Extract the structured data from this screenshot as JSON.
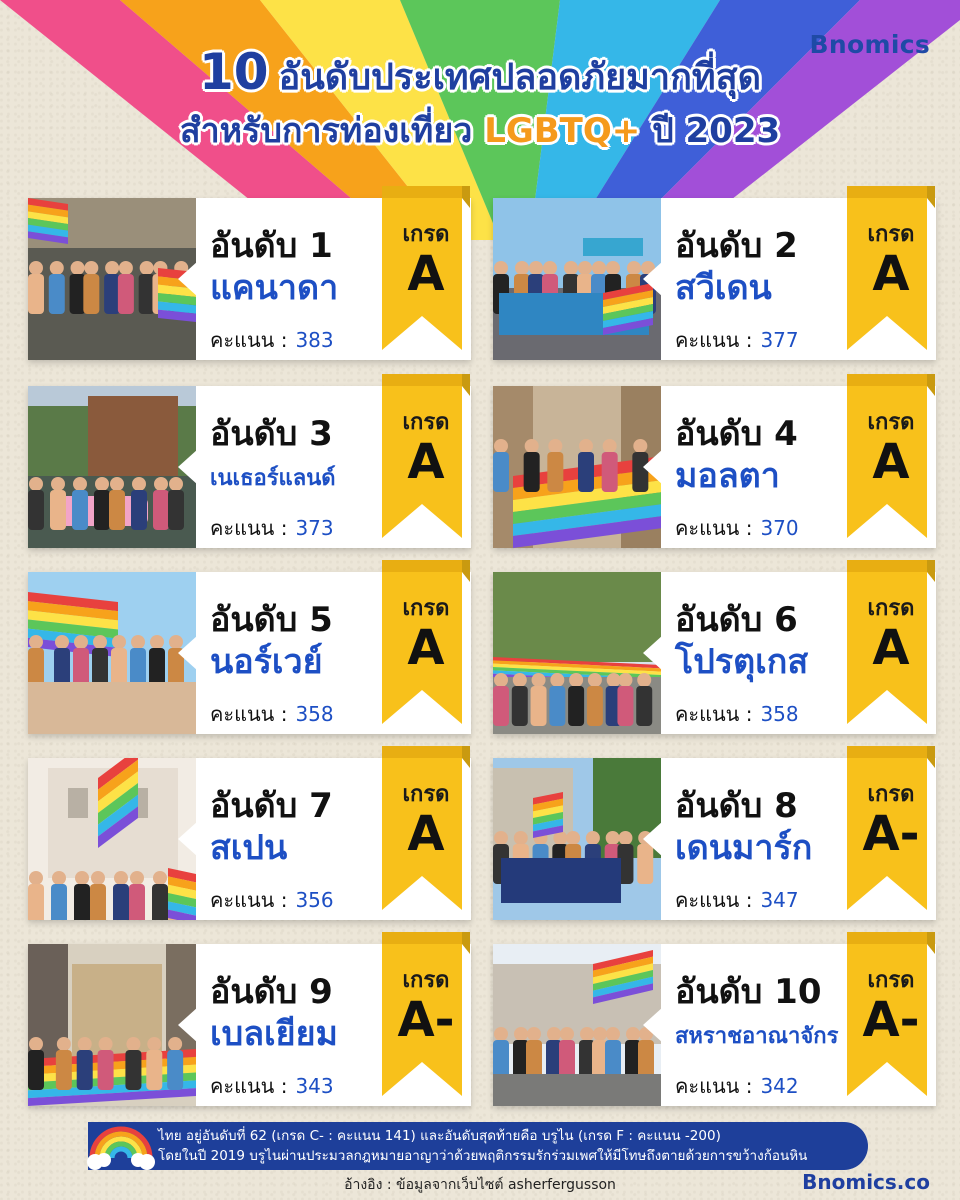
{
  "brand": "Bnomics",
  "title": {
    "number": "10",
    "line1": "อันดับประเทศปลอดภัยมากที่สุด",
    "line2_pre": "สำหรับการท่องเที่ยว",
    "line2_highlight": "LGBTQ+",
    "line2_post": "ปี 2023"
  },
  "labels": {
    "grade": "เกรด",
    "score": "คะแนน :"
  },
  "colors": {
    "title_blue": "#1f3fa0",
    "accent_orange": "#f59a1c",
    "country_blue": "#1d4fc4",
    "ribbon_yellow": "#f8c11b",
    "footer_blue": "#1e3f9a"
  },
  "rankings": [
    {
      "rank": "อันดับ 1",
      "country": "แคนาดา",
      "score": "383",
      "grade": "A",
      "photo": "parade-crowd"
    },
    {
      "rank": "อันดับ 2",
      "country": "สวีเดน",
      "score": "377",
      "grade": "A",
      "photo": "sweden-loves-equality-banner"
    },
    {
      "rank": "อันดับ 3",
      "country": "เนเธอร์แลนด์",
      "score": "373",
      "grade": "A",
      "photo": "canal-boat-parade"
    },
    {
      "rank": "อันดับ 4",
      "country": "มอลตา",
      "score": "370",
      "grade": "A",
      "photo": "giant-rainbow-flag-street"
    },
    {
      "rank": "อันดับ 5",
      "country": "นอร์เวย์",
      "score": "358",
      "grade": "A",
      "photo": "rainbow-flags-crowd"
    },
    {
      "rank": "อันดับ 6",
      "country": "โปรตุเกส",
      "score": "358",
      "grade": "A",
      "photo": "rainbow-flag-march"
    },
    {
      "rank": "อันดับ 7",
      "country": "สเปน",
      "score": "356",
      "grade": "A",
      "photo": "building-with-flags"
    },
    {
      "rank": "อันดับ 8",
      "country": "เดนมาร์ก",
      "score": "347",
      "grade": "A-",
      "photo": "copenhagen-pride-banner"
    },
    {
      "rank": "อันดับ 9",
      "country": "เบลเยียม",
      "score": "343",
      "grade": "A-",
      "photo": "grand-place-rainbow-flag"
    },
    {
      "rank": "อันดับ 10",
      "country": "สหราชอาณาจักร",
      "score": "342",
      "grade": "A-",
      "photo": "london-pride-parade"
    }
  ],
  "footer": {
    "line1": "ไทย อยู่อันดับที่ 62 (เกรด C- : คะแนน 141) และอันดับสุดท้ายคือ บรูไน (เกรด F : คะแนน -200)",
    "line2": "โดยในปี 2019 บรูไนผ่านประมวลกฎหมายอาญาว่าด้วยพฤติกรรมรักร่วมเพศให้มีโทษถึงตายด้วยการขว้างก้อนหิน",
    "source": "อ้างอิง : ข้อมูลจากเว็บไซต์ asherfergusson",
    "site": "Bnomics.co"
  }
}
